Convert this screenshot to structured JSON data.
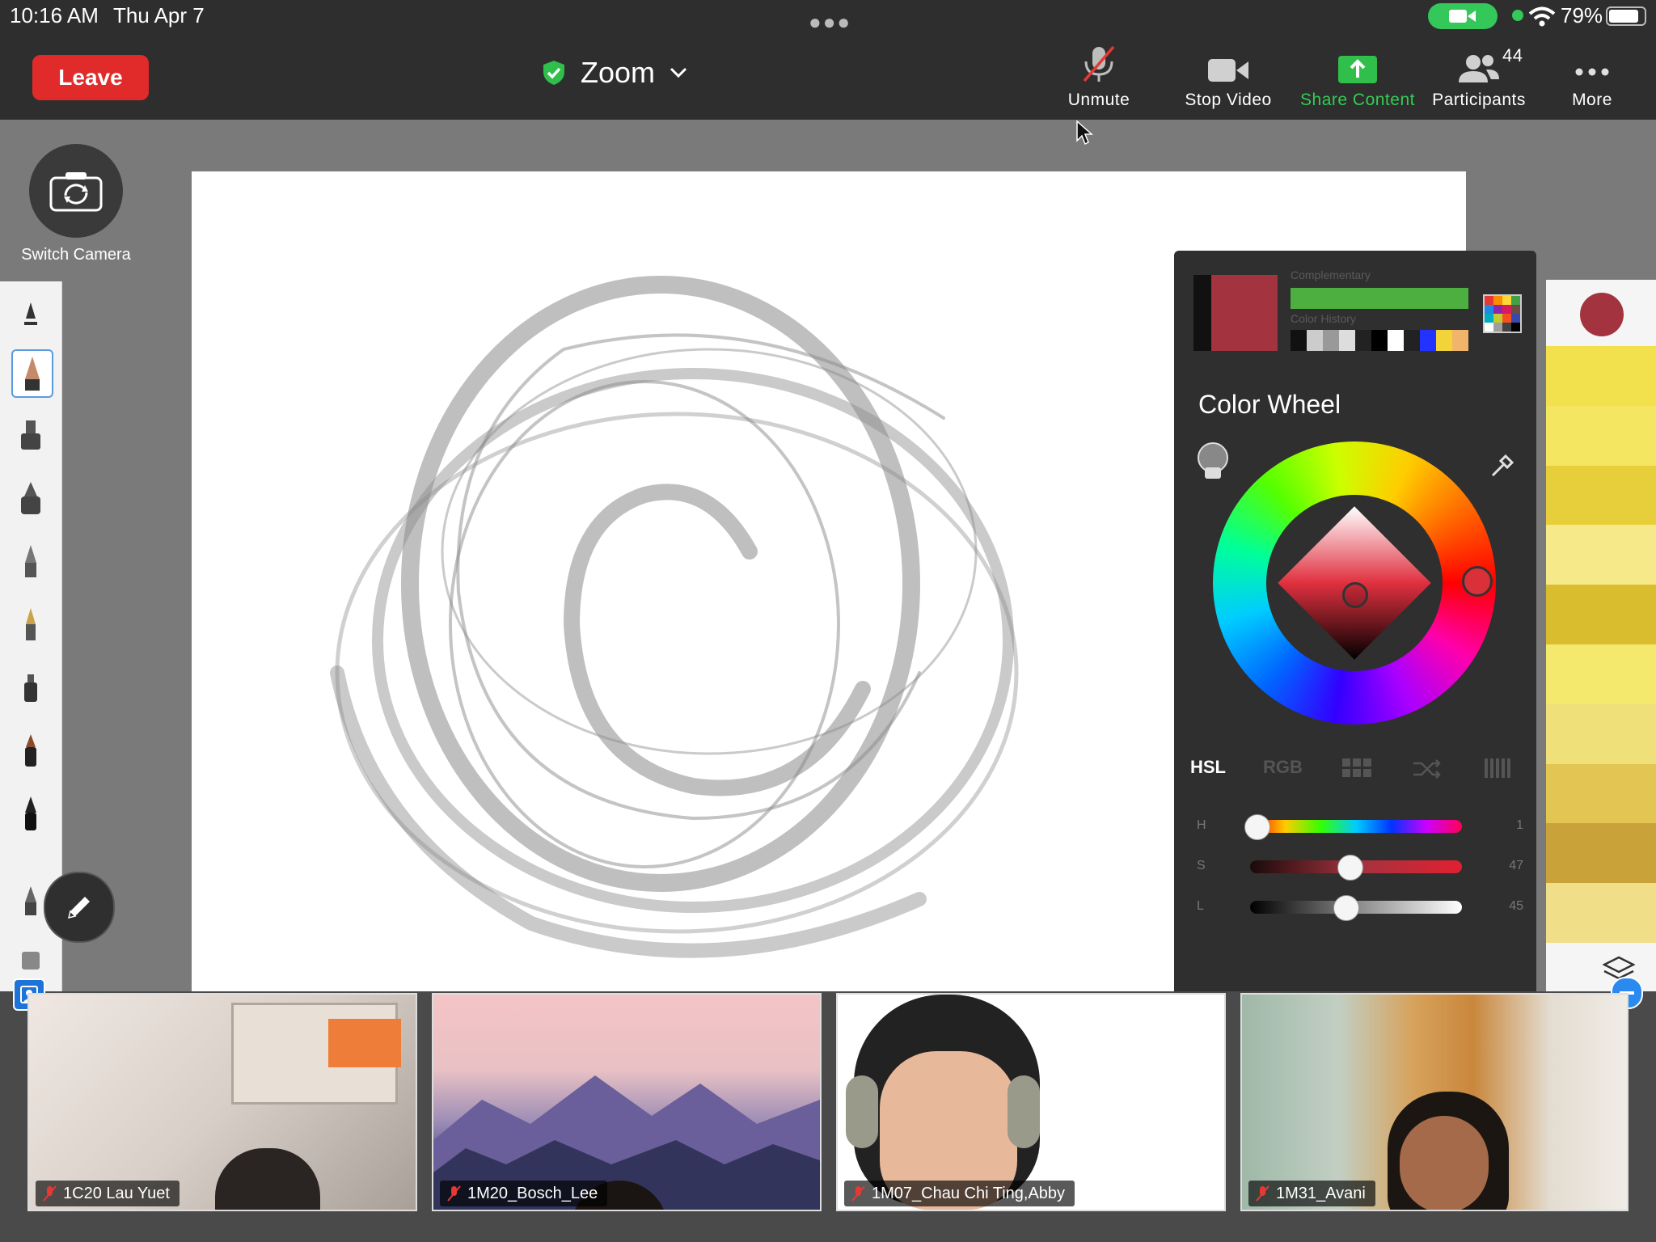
{
  "status_bar": {
    "time": "10:16 AM",
    "date": "Thu Apr 7",
    "battery": "79%"
  },
  "toolbar": {
    "leave_label": "Leave",
    "meeting_title": "Zoom",
    "buttons": {
      "unmute": "Unmute",
      "stop_video": "Stop Video",
      "share_content": "Share Content",
      "participants": "Participants",
      "participants_count": "44",
      "more": "More"
    }
  },
  "switch_camera_label": "Switch Camera",
  "color_panel": {
    "complementary_label": "Complementary",
    "history_label": "Color History",
    "current_color": "#a3333f",
    "complementary_color": "#4caf3f",
    "history": [
      "#111111",
      "#cccccc",
      "#999999",
      "#dddddd",
      "#222222",
      "#000000",
      "#ffffff",
      "#222222",
      "#2233ff",
      "#f2d33a",
      "#f0b46a"
    ],
    "title": "Color Wheel",
    "modes": [
      "HSL",
      "RGB"
    ],
    "active_mode": "HSL",
    "sliders": [
      {
        "label": "H",
        "value": "1",
        "fraction": 0.0
      },
      {
        "label": "S",
        "value": "47",
        "fraction": 0.47
      },
      {
        "label": "L",
        "value": "45",
        "fraction": 0.45
      }
    ]
  },
  "right_strip_colors": [
    "#f2e14d",
    "#f4e660",
    "#e6cf3a",
    "#f6e98a",
    "#d9bd2e",
    "#f5e96d",
    "#efe07a",
    "#e2c552",
    "#c9a23a",
    "#f0de88"
  ],
  "participants": [
    {
      "name": "1C20 Lau Yuet"
    },
    {
      "name": "1M20_Bosch_Lee"
    },
    {
      "name": "1M07_Chau Chi Ting,Abby"
    },
    {
      "name": "1M31_Avani"
    }
  ]
}
